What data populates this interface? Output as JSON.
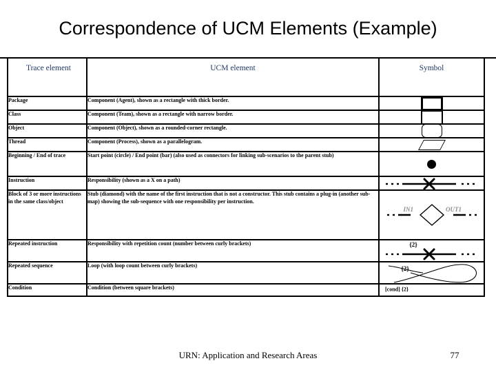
{
  "slide": {
    "title": "Correspondence of UCM Elements (Example)",
    "footer_text": "URN: Application and Research Areas",
    "page_number": "77"
  },
  "table": {
    "headers": {
      "trace": "Trace element",
      "ucm": "UCM element",
      "symbol": "Symbol"
    },
    "header_color": "#1f3864",
    "rows": [
      {
        "trace": "Package",
        "ucm": "Component (Agent), shown as a rectangle with thick border.",
        "symbol_kind": "rect-thick",
        "symbol_text": ""
      },
      {
        "trace": "Class",
        "ucm": "Component (Team), shown as a rectangle with narrow border.",
        "symbol_kind": "rect-thin",
        "symbol_text": ""
      },
      {
        "trace": "Object",
        "ucm": "Component (Object), shown as a rounded-corner rectangle.",
        "symbol_kind": "rect-rounded",
        "symbol_text": ""
      },
      {
        "trace": "Thread",
        "ucm": "Component (Process), shown as a parallelogram.",
        "symbol_kind": "parallelogram",
        "symbol_text": ""
      },
      {
        "trace": "Beginning / End of trace",
        "ucm": "Start point (circle) / End point (bar) (also used as connectors for linking sub-scenarios to the parent stub)",
        "symbol_kind": "filled-circle",
        "symbol_text": ""
      },
      {
        "trace": "Instruction",
        "ucm": "Responsibility (shown as a X on a path)",
        "symbol_kind": "path-with-x",
        "symbol_text": ""
      },
      {
        "trace": "Block of 3 or more instructions in the same class/object",
        "ucm": "Stub (diamond) with the name of the first instruction that is not a constructor. This stub contains a plug-in (another sub-map) showing the sub-sequence with one responsibility per instruction.",
        "symbol_kind": "stub-diamond",
        "symbol_text": "",
        "stub_in_label": "IN1",
        "stub_out_label": "OUT1"
      },
      {
        "trace": "Repeated instruction",
        "ucm": "Responsibility with repetition count (number between curly brackets)",
        "symbol_kind": "path-with-x-count",
        "symbol_text": "{2}"
      },
      {
        "trace": "Repeated sequence",
        "ucm": "Loop (with loop count between curly brackets)",
        "symbol_kind": "loop-curve",
        "symbol_text": "{2}"
      },
      {
        "trace": "Condition",
        "ucm": "Condition (between square brackets)",
        "symbol_kind": "text-only",
        "symbol_text": "[cond] {2}"
      }
    ]
  }
}
